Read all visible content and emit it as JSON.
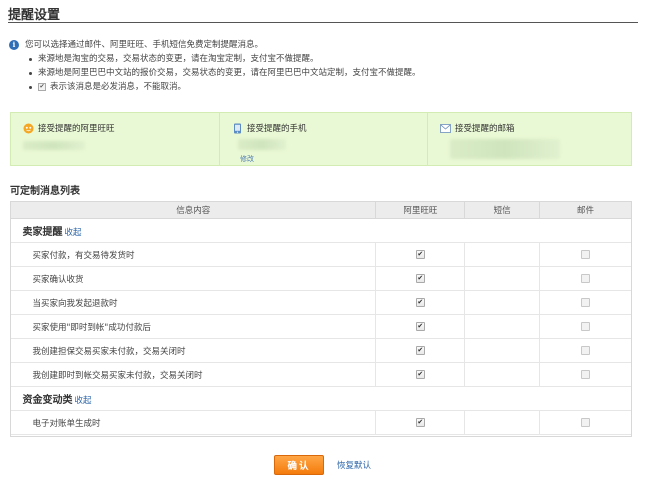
{
  "page": {
    "title": "提醒设置"
  },
  "notice": {
    "intro": "您可以选择通过邮件、阿里旺旺、手机短信免费定制提醒消息。",
    "bullets": [
      "来源地是淘宝的交易，交易状态的变更，请在淘宝定制，支付宝不做提醒。",
      "来源地是阿里巴巴中文站的报价交易，交易状态的变更，请在阿里巴巴中文站定制，支付宝不做提醒。"
    ],
    "check_note": "表示该消息是必发消息，不能取消。"
  },
  "contact": {
    "wangwang_label": "接受提醒的阿里旺旺",
    "phone_label": "接受提醒的手机",
    "phone_edit": "修改",
    "email_label": "接受提醒的邮箱"
  },
  "list": {
    "title": "可定制消息列表",
    "headers": [
      "信息内容",
      "阿里旺旺",
      "短信",
      "邮件"
    ],
    "groups": [
      {
        "name": "卖家提醒",
        "collapse": "收起",
        "rows": [
          {
            "label": "买家付款，有交易待发货时",
            "wangwang": true,
            "sms": false,
            "email": false
          },
          {
            "label": "买家确认收货",
            "wangwang": true,
            "sms": false,
            "email": false
          },
          {
            "label": "当买家向我发起退款时",
            "wangwang": true,
            "sms": false,
            "email": false
          },
          {
            "label": "买家使用\"即时到帐\"成功付款后",
            "wangwang": true,
            "sms": false,
            "email": false
          },
          {
            "label": "我创建担保交易买家未付款，交易关闭时",
            "wangwang": true,
            "sms": false,
            "email": false
          },
          {
            "label": "我创建即时到帐交易买家未付款，交易关闭时",
            "wangwang": true,
            "sms": false,
            "email": false
          }
        ]
      },
      {
        "name": "资金变动类",
        "collapse": "收起",
        "rows": [
          {
            "label": "电子对账单生成时",
            "wangwang": true,
            "sms": false,
            "email": false
          }
        ]
      }
    ]
  },
  "actions": {
    "confirm": "确认",
    "restore": "恢复默认"
  },
  "colors": {
    "accent_orange": "#f47b0c",
    "link_blue": "#2a64a8",
    "contact_bg": "#eaf9d5"
  }
}
